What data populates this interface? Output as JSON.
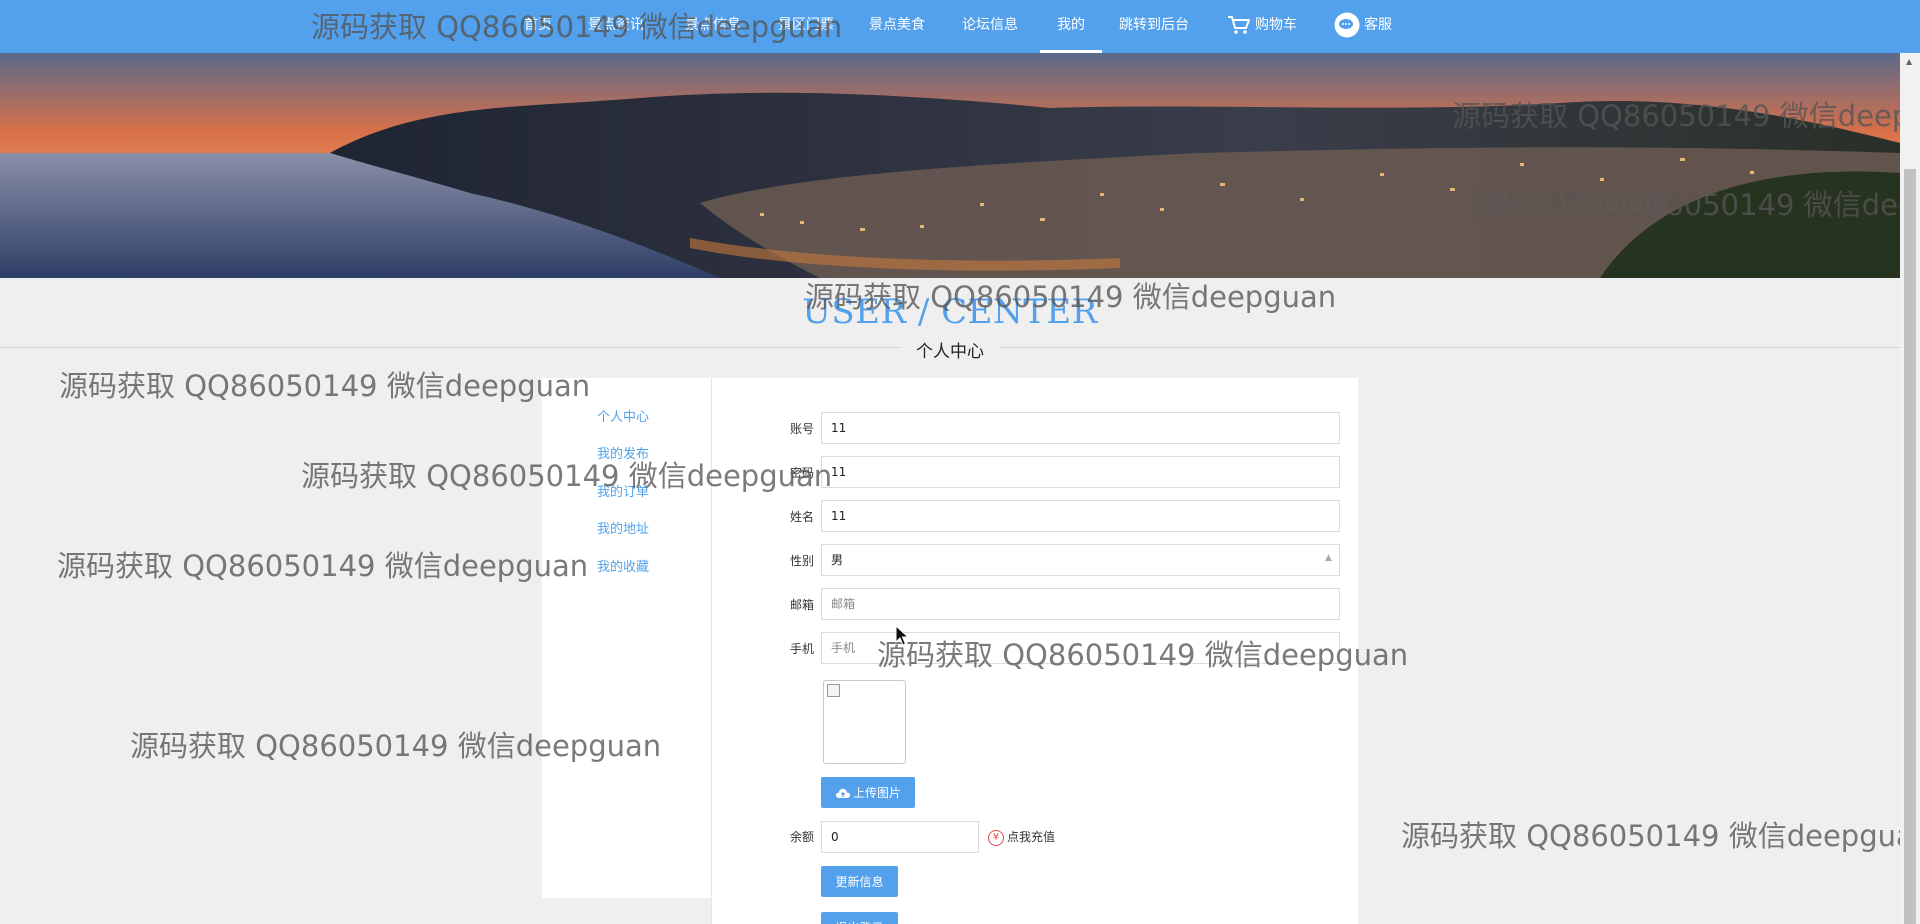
{
  "nav": {
    "items": [
      "首页",
      "景点资讯",
      "景点信息",
      "景区门票",
      "景点美食",
      "论坛信息",
      "我的",
      "跳转到后台",
      "购物车",
      "客服"
    ],
    "active_index": 6
  },
  "hero": {
    "title": "USER / CENTER",
    "subtitle": "个人中心"
  },
  "sidebar": {
    "items": [
      "个人中心",
      "我的发布",
      "我的订单",
      "我的地址",
      "我的收藏"
    ]
  },
  "form": {
    "account": {
      "label": "账号",
      "value": "11"
    },
    "password": {
      "label": "密码",
      "value": "11"
    },
    "name": {
      "label": "姓名",
      "value": "11"
    },
    "gender": {
      "label": "性别",
      "value": "男"
    },
    "email": {
      "label": "邮箱",
      "placeholder": "邮箱"
    },
    "phone": {
      "label": "手机",
      "placeholder": "手机"
    },
    "upload_label": "上传图片",
    "balance": {
      "label": "余额",
      "value": "0"
    },
    "recharge_label": "点我充值",
    "update_label": "更新信息",
    "logout_label": "退出登录"
  },
  "watermark": "源码获取 QQ86050149 微信deepguan",
  "colors": {
    "accent": "#53a1ec",
    "nav_bg": "#53a1ec",
    "page_bg": "#efefef"
  },
  "icons": {
    "cart": "cart-icon",
    "service": "chat-bubble-icon",
    "upload": "cloud-upload-icon",
    "recharge": "yen-icon"
  }
}
